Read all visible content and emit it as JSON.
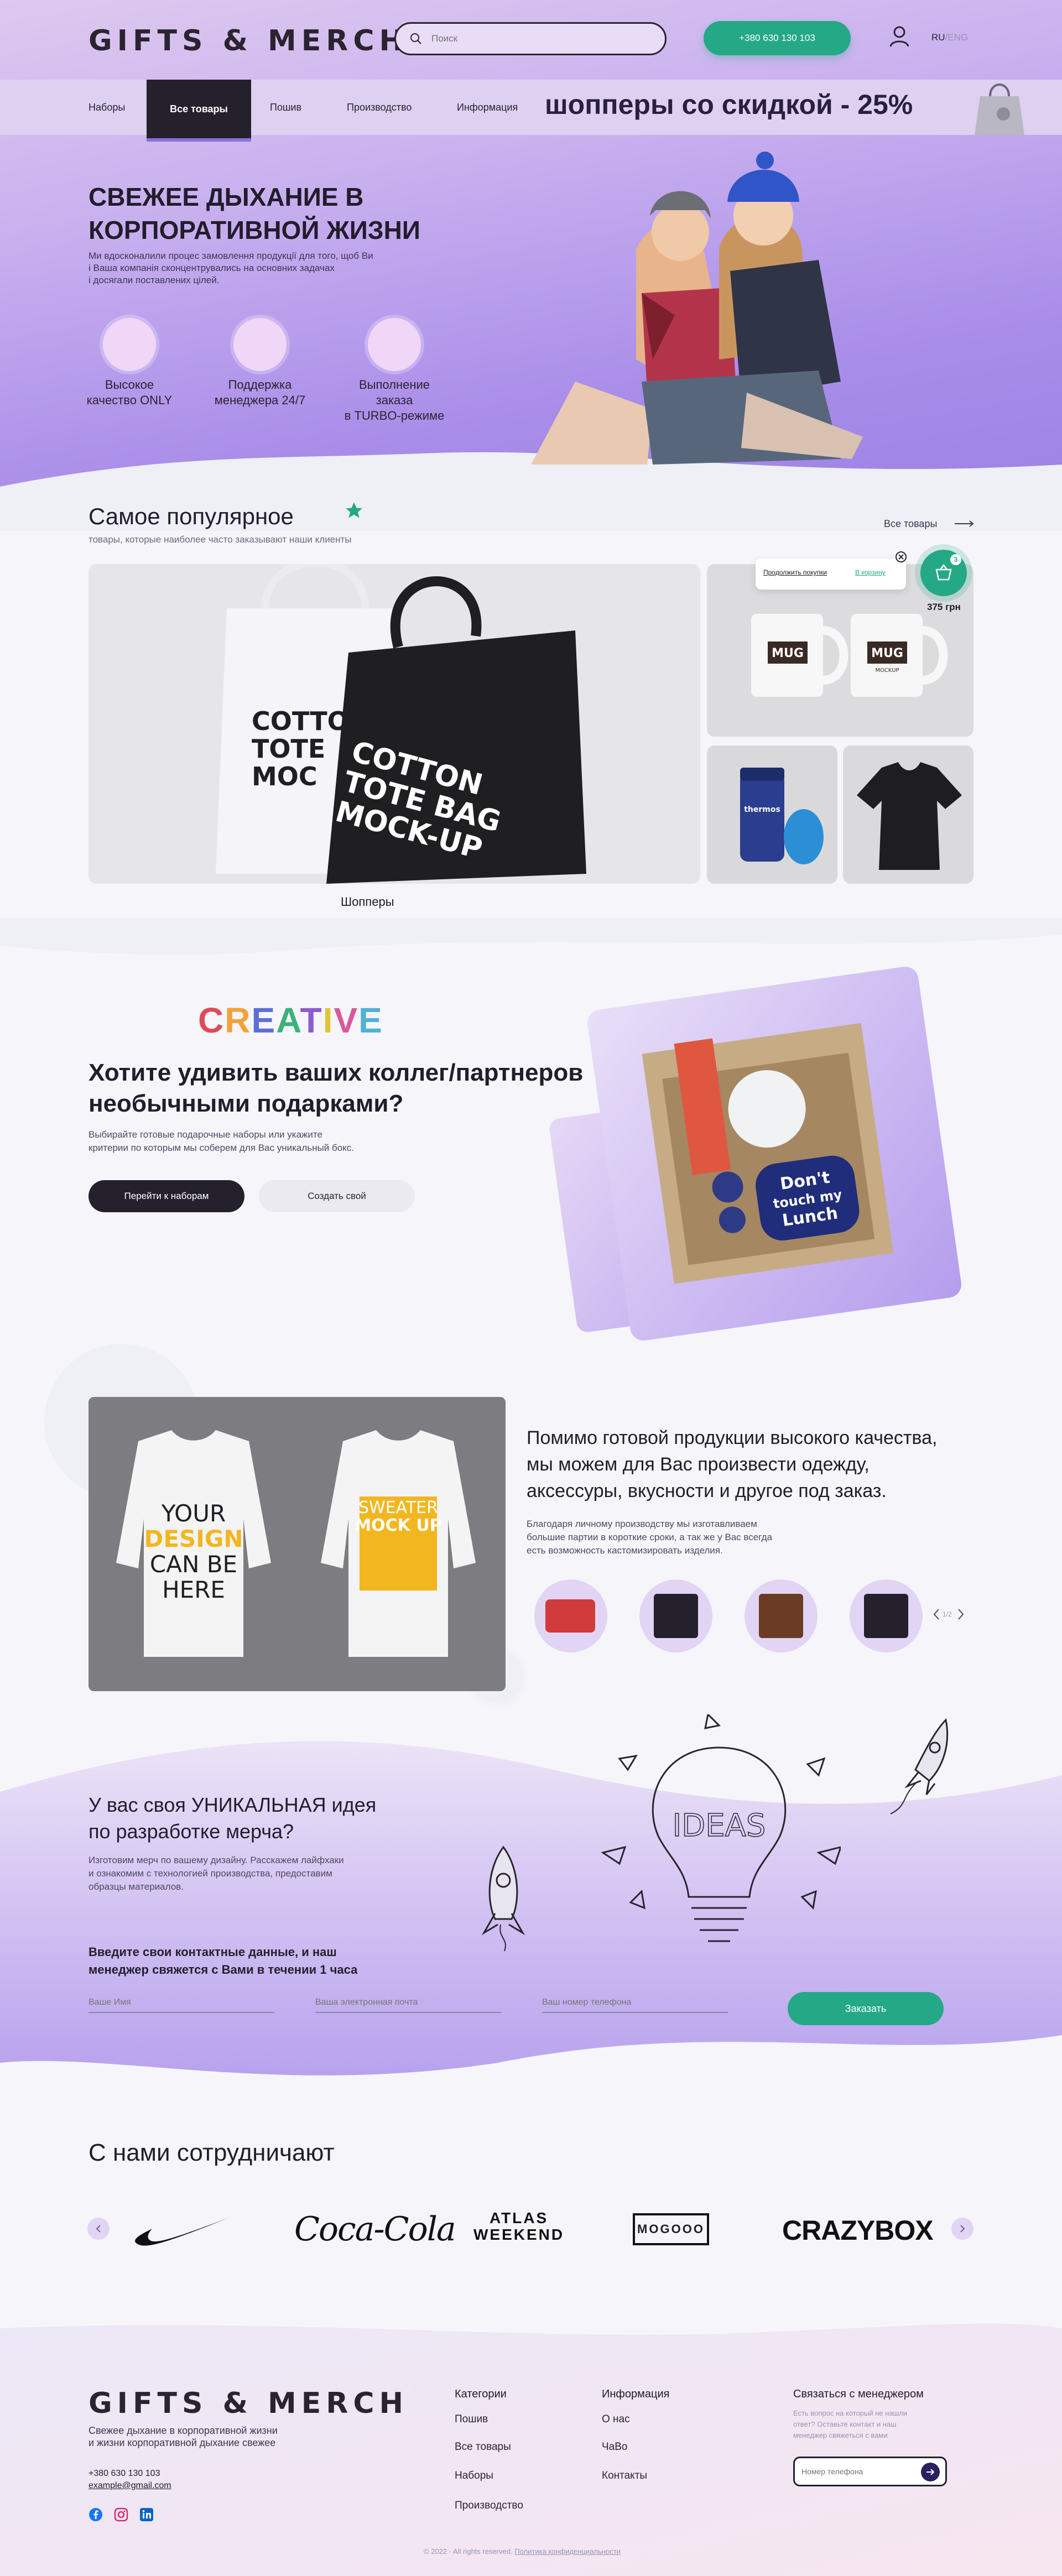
{
  "header": {
    "logo": "GIFTS & MERCH",
    "search_placeholder": "Поиск",
    "phone": "+380 630 130 103",
    "lang_ru": "RU",
    "lang_sep": "/",
    "lang_eng": "ENG"
  },
  "nav": {
    "items": [
      "Наборы",
      "Все товары",
      "Пошив",
      "Производство",
      "Информация"
    ],
    "promo": "шопперы со скидкой - 25%"
  },
  "hero": {
    "title_line1": "СВЕЖЕЕ ДЫХАНИЕ В",
    "title_line2": "КОРПОРАТИВНОЙ ЖИЗНИ",
    "text_line1": "Ми вдосконалили процес замовлення продукції для того, щоб Ви",
    "text_line2": "і Ваша компанія сконцентрувались на основних задачах",
    "text_line3": "і досягали поставлених цілей.",
    "features": [
      {
        "line1": "Высокое",
        "line2": "качество ONLY"
      },
      {
        "line1": "Поддержка",
        "line2": "менеджера 24/7"
      },
      {
        "line1": "Выполнение",
        "line2": "заказа",
        "line3": "в TURBO-режиме"
      }
    ]
  },
  "popular": {
    "title": "Самое популярное",
    "subtitle": "товары, которые наиболее часто заказывают наши клиенты",
    "all_link": "Все товары",
    "cart_tooltip_continue": "Продолжить покупки",
    "cart_tooltip_cart": "В корзину",
    "cart_count": "3",
    "cart_total": "375 грн",
    "tote_big_text": [
      "COTTON",
      "TOTE BAG",
      "MOCK-UP"
    ],
    "tote_white_text": [
      "COTTO",
      "TOTE",
      "MOC"
    ],
    "mug_label": "MUG",
    "mug_sub": "MOCKUP",
    "thermos_label": "thermos",
    "shoppers_caption": "Шопперы"
  },
  "creative": {
    "word": "CREATIVE",
    "title_line1": "Хотите удивить ваших коллег/партнеров",
    "title_line2": "необычными подарками?",
    "text_line1": "Выбирайте готовые подарочные наборы или укажите",
    "text_line2": "критерии по которым мы соберем для Вас уникальный бокс.",
    "btn_sets": "Перейти к наборам",
    "btn_create": "Создать свой",
    "box_text": [
      "Don't",
      "touch my",
      "Lunch"
    ]
  },
  "production": {
    "title_line1": "Помимо готовой продукции высокого качества,",
    "title_line2": "мы можем для Вас произвести одежду,",
    "title_line3": "аксессуры, вкусности и другое под заказ.",
    "text_line1": "Благодаря личному производству мы изготавливаем",
    "text_line2": "большие партии в короткие сроки, а так же у Вас всегда",
    "text_line3": "есть возможность кастомизировать изделия.",
    "sweater1": [
      "YOUR",
      "DESIGN",
      "CAN BE",
      "HERE"
    ],
    "sweater2": [
      "SWEATER",
      "MOCK UP"
    ],
    "carousel_label": "1/2"
  },
  "idea": {
    "title_line1": "У вас своя УНИКАЛЬНАЯ идея",
    "title_line2": "по разработке мерча?",
    "text_line1": "Изготовим мерч по вашему дизайну. Расскажем лайфхаки",
    "text_line2": "и ознакомим с  технологией производства, предоставим",
    "text_line3": "образцы материалов.",
    "contact_line1": "Введите свои контактные данные, и наш",
    "contact_line2": "менеджер свяжется с Вами в течении 1 часа",
    "name_placeholder": "Ваше Имя",
    "email_placeholder": "Ваша электронная почта",
    "phone_placeholder": "Ваш номер телефона",
    "order_btn": "Заказать",
    "bulb_word": "IDEAS"
  },
  "partners": {
    "title": "С нами сотрудничают",
    "logos": [
      "Coca-Cola",
      "ATLAS",
      "WEEKEND",
      "MOGOOO",
      "CRAZYBOX"
    ]
  },
  "footer": {
    "logo": "GIFTS & MERCH",
    "tagline_line1": "Свежее дыхание в корпоративной жизни",
    "tagline_line2": "и жизни корпоративной дыхание свежее",
    "phone": "+380 630 130 103",
    "email": "example@gmail.com",
    "categories_title": "Категории",
    "categories": [
      "Пошив",
      "Все товары",
      "Наборы",
      "Производство"
    ],
    "info_title": "Информация",
    "info": [
      "О нас",
      "ЧаВо",
      "Контакты"
    ],
    "contact_title": "Связаться с менеджером",
    "contact_text_line1": "Есть вопрос на который не нашли",
    "contact_text_line2": "ответ? Оставьте контакт и наш",
    "contact_text_line3": "менеджер свяжеться с вами",
    "contact_placeholder": "Номер телефона",
    "copyright": "© 2022 - All rights reserved.",
    "privacy": "Политика конфиденциальности"
  },
  "colors": {
    "accent_green": "#25a886",
    "dark": "#24212d",
    "lavender": "#a98de9"
  }
}
